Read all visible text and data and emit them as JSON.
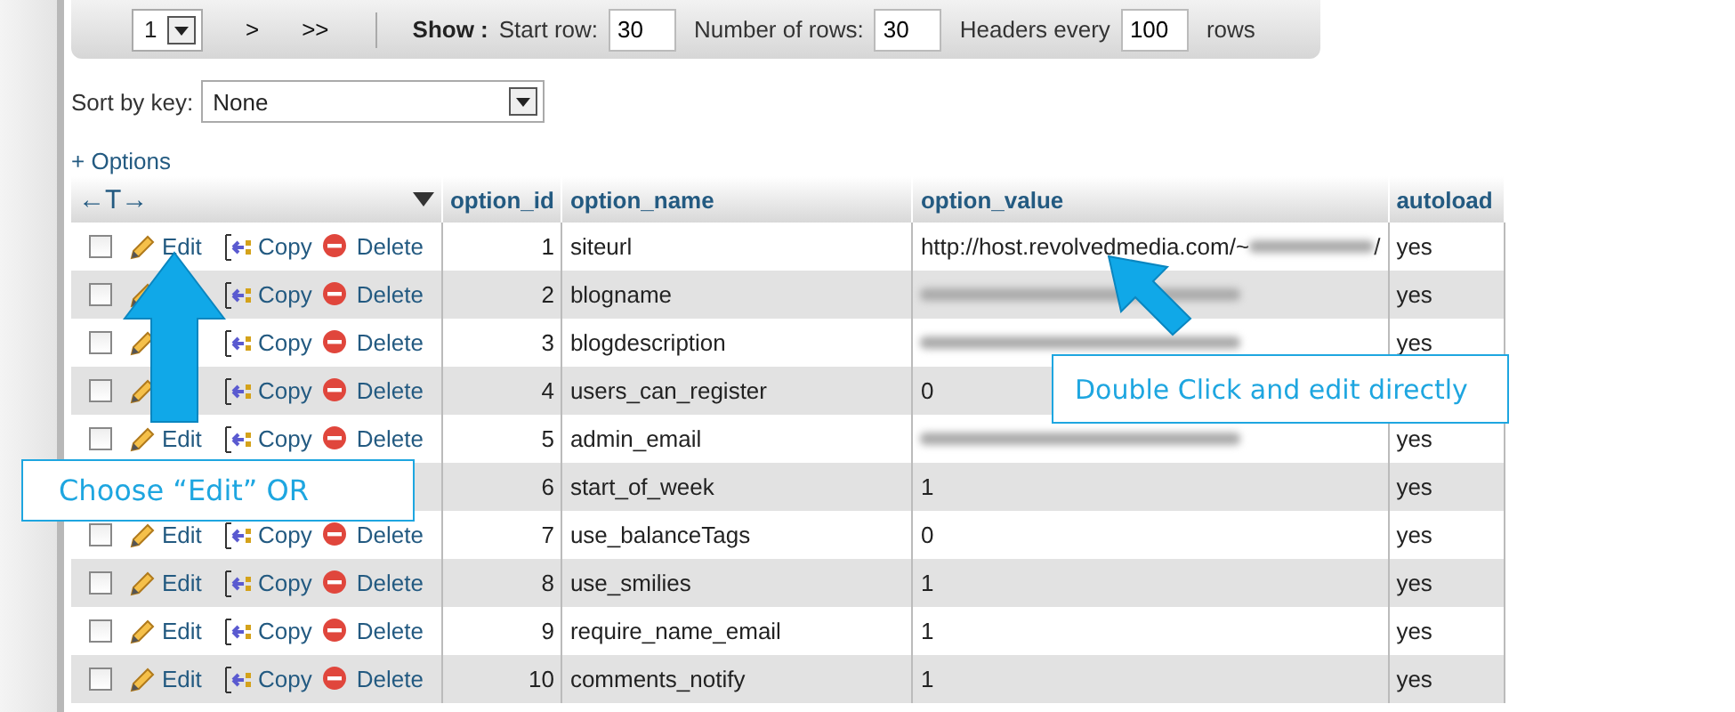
{
  "navigation": {
    "page": "1",
    "next": ">",
    "last": ">>",
    "show_label": "Show :",
    "start_row_label": "Start row:",
    "start_row": "30",
    "rows_label": "Number of rows:",
    "rows": "30",
    "headers_label": "Headers every",
    "headers": "100",
    "rows_suffix": "rows"
  },
  "sort": {
    "label": "Sort by key:",
    "value": "None"
  },
  "options_link": "+ Options",
  "table": {
    "resize_label": "←T→",
    "columns": [
      "option_id",
      "option_name",
      "option_value",
      "autoload"
    ],
    "rows": [
      {
        "checked": false,
        "actions": [
          {
            "kind": "edit",
            "label": "Edit"
          },
          {
            "kind": "copy",
            "label": "Copy"
          },
          {
            "kind": "delete",
            "label": "Delete"
          }
        ],
        "id": "1",
        "name": "siteurl",
        "value_parts": [
          {
            "kind": "text",
            "text": "http://host.revolvedmedia.com/~"
          },
          {
            "kind": "redacted"
          },
          {
            "kind": "text",
            "text": "/"
          }
        ],
        "autoload": "yes"
      },
      {
        "checked": false,
        "actions": [
          {
            "kind": "edit"
          },
          {
            "kind": "copy",
            "label": "Copy"
          },
          {
            "kind": "delete",
            "label": "Delete"
          }
        ],
        "id": "2",
        "name": "blogname",
        "value_parts": [
          {
            "kind": "redacted"
          }
        ],
        "autoload": "yes"
      },
      {
        "checked": false,
        "actions": [
          {
            "kind": "edit"
          },
          {
            "kind": "copy",
            "label": "Copy"
          },
          {
            "kind": "delete",
            "label": "Delete"
          }
        ],
        "id": "3",
        "name": "blogdescription",
        "value_parts": [
          {
            "kind": "redacted"
          }
        ],
        "autoload": "yes"
      },
      {
        "checked": false,
        "actions": [
          {
            "kind": "edit"
          },
          {
            "kind": "copy",
            "label": "Copy"
          },
          {
            "kind": "delete",
            "label": "Delete"
          }
        ],
        "id": "4",
        "name": "users_can_register",
        "value_parts": [
          {
            "kind": "text",
            "text": "0"
          }
        ]
      },
      {
        "checked": false,
        "actions": [
          {
            "kind": "edit",
            "label": "Edit"
          },
          {
            "kind": "copy",
            "label": "Copy"
          },
          {
            "kind": "delete",
            "label": "Delete"
          }
        ],
        "id": "5",
        "name": "admin_email",
        "value_parts": [
          {
            "kind": "redacted"
          }
        ],
        "autoload": "yes"
      },
      {
        "actions": [],
        "id": "6",
        "name": "start_of_week",
        "value_parts": [
          {
            "kind": "text",
            "text": "1"
          }
        ],
        "autoload": "yes"
      },
      {
        "checked": false,
        "actions": [
          {
            "kind": "edit",
            "label": "Edit"
          },
          {
            "kind": "copy",
            "label": "Copy"
          },
          {
            "kind": "delete",
            "label": "Delete"
          }
        ],
        "id": "7",
        "name": "use_balanceTags",
        "value_parts": [
          {
            "kind": "text",
            "text": "0"
          }
        ],
        "autoload": "yes"
      },
      {
        "checked": false,
        "actions": [
          {
            "kind": "edit",
            "label": "Edit"
          },
          {
            "kind": "copy",
            "label": "Copy"
          },
          {
            "kind": "delete",
            "label": "Delete"
          }
        ],
        "id": "8",
        "name": "use_smilies",
        "value_parts": [
          {
            "kind": "text",
            "text": "1"
          }
        ],
        "autoload": "yes"
      },
      {
        "checked": false,
        "actions": [
          {
            "kind": "edit",
            "label": "Edit"
          },
          {
            "kind": "copy",
            "label": "Copy"
          },
          {
            "kind": "delete",
            "label": "Delete"
          }
        ],
        "id": "9",
        "name": "require_name_email",
        "value_parts": [
          {
            "kind": "text",
            "text": "1"
          }
        ],
        "autoload": "yes"
      },
      {
        "checked": false,
        "actions": [
          {
            "kind": "edit",
            "label": "Edit"
          },
          {
            "kind": "copy",
            "label": "Copy"
          },
          {
            "kind": "delete",
            "label": "Delete"
          }
        ],
        "id": "10",
        "name": "comments_notify",
        "value_parts": [
          {
            "kind": "text",
            "text": "1"
          }
        ],
        "autoload": "yes"
      }
    ]
  },
  "callouts": [
    {
      "kind": "up",
      "text": "Choose “Edit” OR"
    },
    {
      "kind": "diagonal",
      "text": "Double Click and edit directly"
    }
  ]
}
